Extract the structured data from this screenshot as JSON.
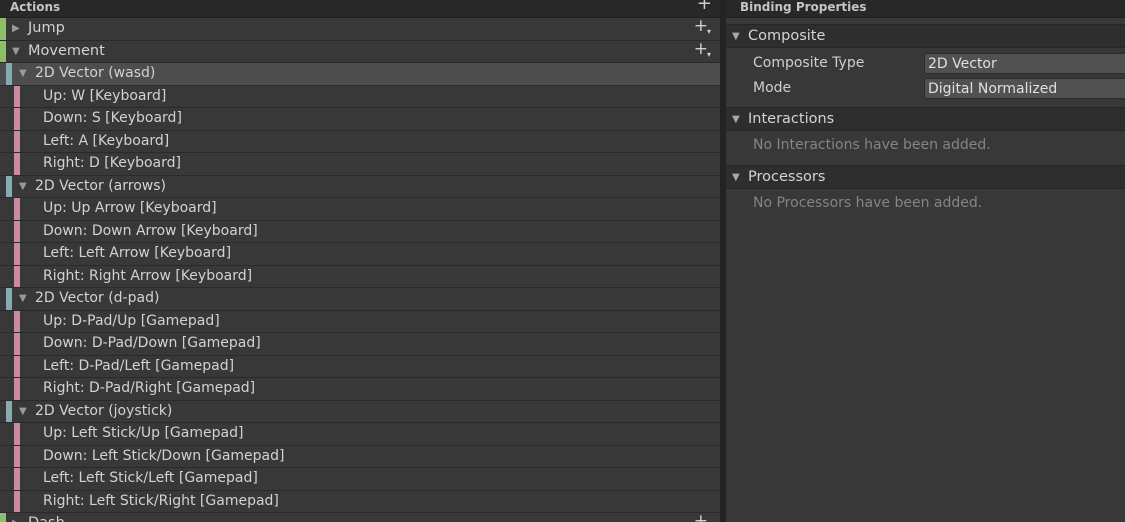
{
  "actions_panel": {
    "title": "Actions",
    "add_icon": "plus-icon",
    "actions": [
      {
        "label": "Jump",
        "expanded": false
      },
      {
        "label": "Movement",
        "expanded": true
      }
    ],
    "composites": [
      {
        "label": "2D Vector (wasd)",
        "selected": true,
        "parts": [
          "Up: W [Keyboard]",
          "Down: S [Keyboard]",
          "Left: A [Keyboard]",
          "Right: D [Keyboard]"
        ]
      },
      {
        "label": "2D Vector (arrows)",
        "selected": false,
        "parts": [
          "Up: Up Arrow [Keyboard]",
          "Down: Down Arrow [Keyboard]",
          "Left: Left Arrow [Keyboard]",
          "Right: Right Arrow [Keyboard]"
        ]
      },
      {
        "label": "2D Vector (d-pad)",
        "selected": false,
        "parts": [
          "Up: D-Pad/Up [Gamepad]",
          "Down: D-Pad/Down [Gamepad]",
          "Left: D-Pad/Left [Gamepad]",
          "Right: D-Pad/Right [Gamepad]"
        ]
      },
      {
        "label": "2D Vector (joystick)",
        "selected": false,
        "parts": [
          "Up: Left Stick/Up [Gamepad]",
          "Down: Left Stick/Down [Gamepad]",
          "Left: Left Stick/Left [Gamepad]",
          "Right: Left Stick/Right [Gamepad]"
        ]
      }
    ],
    "partial_action_label": "Dash"
  },
  "binding_panel": {
    "title": "Binding Properties",
    "composite_section": {
      "title": "Composite",
      "composite_type_label": "Composite Type",
      "composite_type_value": "2D Vector",
      "mode_label": "Mode",
      "mode_value": "Digital Normalized"
    },
    "interactions_section": {
      "title": "Interactions",
      "empty_text": "No Interactions have been added."
    },
    "processors_section": {
      "title": "Processors",
      "empty_text": "No Processors have been added."
    }
  },
  "colors": {
    "action_stripe": "#8dbf6a",
    "composite_stripe": "#86abb0",
    "part_stripe": "#c98aa2",
    "selected_row": "#4d4d4d"
  }
}
